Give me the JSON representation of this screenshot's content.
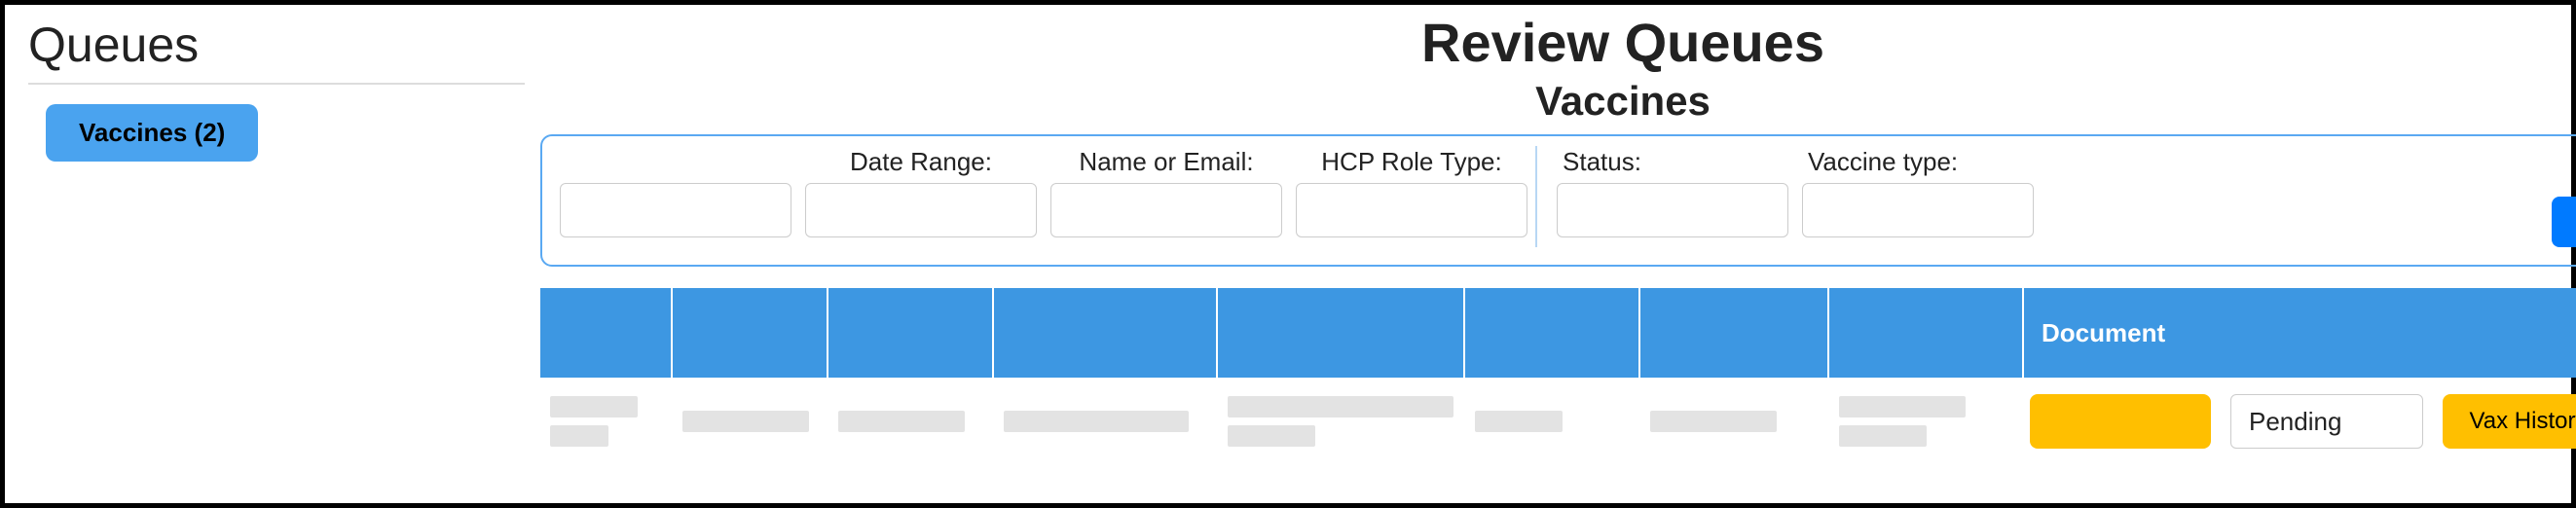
{
  "sidebar": {
    "title": "Queues",
    "items": [
      {
        "label": "Vaccines (2)"
      }
    ]
  },
  "header": {
    "page_title": "Review Queues",
    "section_title": "Vaccines"
  },
  "filters": {
    "date_range_label": "Date Range:",
    "name_email_label": "Name or Email:",
    "hcp_role_label": "HCP Role Type:",
    "status_label": "Status:",
    "vaccine_type_label": "Vaccine type:",
    "toggle_on": false,
    "submit_label": ""
  },
  "table": {
    "columns": [
      "",
      "",
      "",
      "",
      "",
      "",
      "",
      "",
      "Document",
      ""
    ],
    "row": {
      "status_text": "Pending",
      "vax_history_label": "Vax History"
    }
  }
}
